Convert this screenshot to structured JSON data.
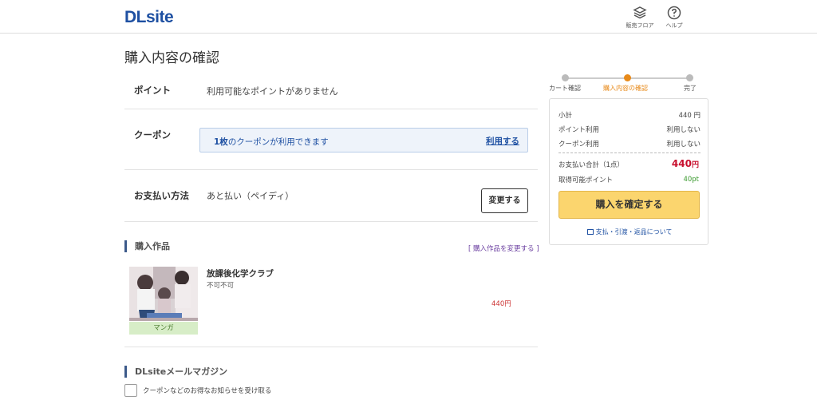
{
  "header": {
    "logo": "DLsite",
    "floor_label": "販売フロア",
    "help_label": "ヘルプ"
  },
  "page_title": "購入内容の確認",
  "point": {
    "label": "ポイント",
    "value": "利用可能なポイントがありません"
  },
  "coupon": {
    "label": "クーポン",
    "count_bold": "1枚",
    "message": "のクーポンが利用できます",
    "use_link": "利用する"
  },
  "payment": {
    "label": "お支払い方法",
    "value": "あと払い（ペイディ）",
    "change_button": "変更する"
  },
  "works_section": {
    "heading": "購入作品",
    "change_link": "[ 購入作品を変更する ]",
    "items": [
      {
        "title": "放課後化学クラブ",
        "circle": "不可不可",
        "genre": "マンガ",
        "price": "440円"
      }
    ]
  },
  "mail_section": {
    "heading": "DLsiteメールマガジン",
    "checkbox_label": "クーポンなどのお得なお知らせを受け取る"
  },
  "steps": [
    {
      "label": "カート確認",
      "active": false
    },
    {
      "label": "購入内容の確認",
      "active": true
    },
    {
      "label": "完了",
      "active": false
    }
  ],
  "summary": {
    "subtotal_label": "小計",
    "subtotal_value": "440 円",
    "point_use_label": "ポイント利用",
    "point_use_value": "利用しない",
    "coupon_use_label": "クーポン利用",
    "coupon_use_value": "利用しない",
    "total_label": "お支払い合計（1点）",
    "total_value": "440",
    "total_unit": "円",
    "earn_label": "取得可能ポイント",
    "earn_value": "40pt",
    "confirm_button": "購入を確定する",
    "payment_info_link": "支払・引渡・返品について"
  },
  "colors": {
    "brand": "#1e50a2",
    "accent": "#e88a1a",
    "price_red": "#c8102e",
    "confirm_yellow": "#fbd56e"
  }
}
